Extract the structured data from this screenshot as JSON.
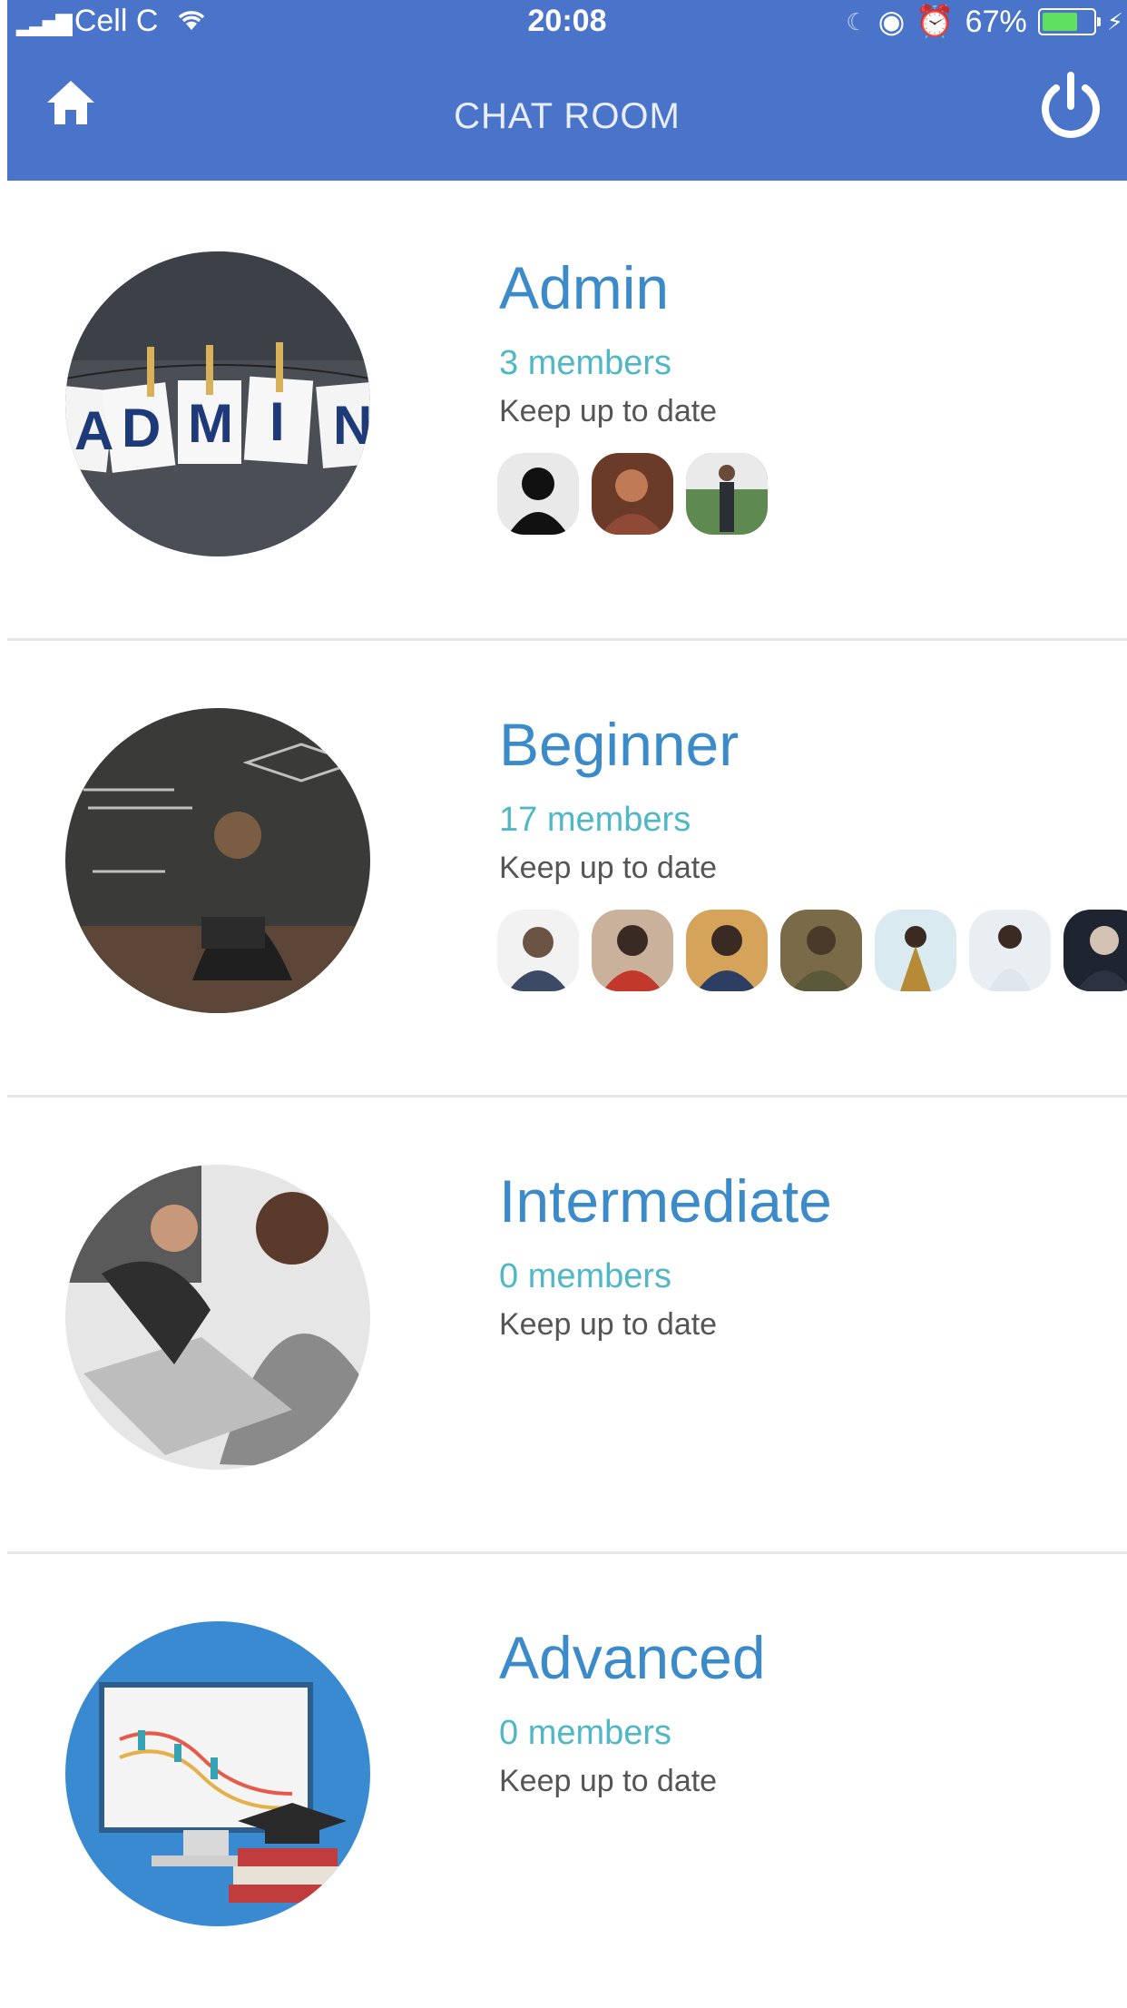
{
  "status_bar": {
    "carrier": "Cell C",
    "time": "20:08",
    "battery": "67%"
  },
  "header": {
    "title": "CHAT ROOM"
  },
  "rooms": [
    {
      "name": "Admin",
      "members": "3 members",
      "subtitle": "Keep up to date"
    },
    {
      "name": "Beginner",
      "members": "17 members",
      "subtitle": "Keep up to date"
    },
    {
      "name": "Intermediate",
      "members": "0 members",
      "subtitle": "Keep up to date"
    },
    {
      "name": "Advanced",
      "members": "0 members",
      "subtitle": "Keep up to date"
    }
  ],
  "cover_text": [
    "A",
    "D",
    "M",
    "I",
    "N"
  ],
  "colors": {
    "app_bar": "#4a74c9",
    "room_name": "#3b8ac9",
    "member_count": "#4fb7c6"
  }
}
